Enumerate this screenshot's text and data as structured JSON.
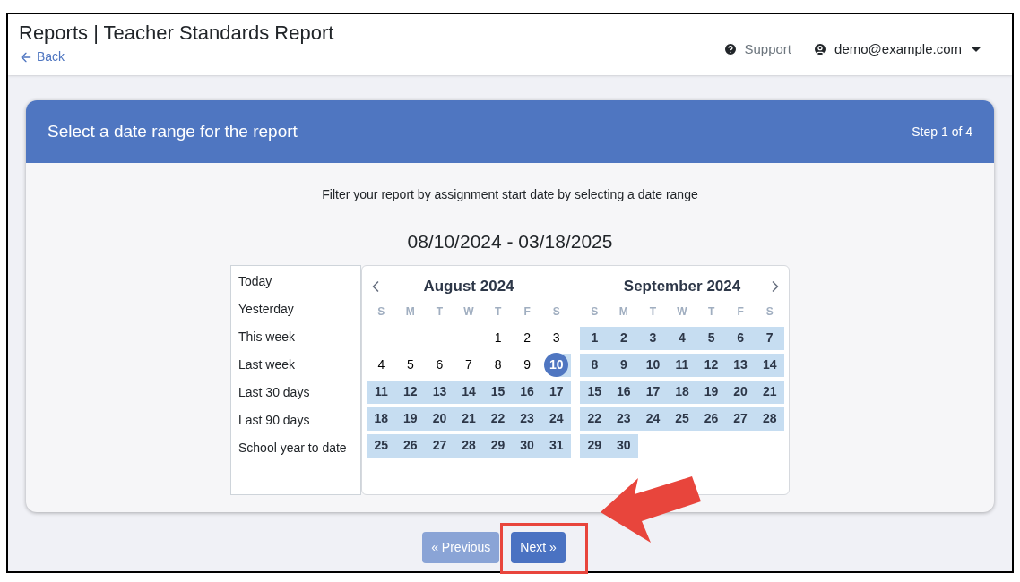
{
  "header": {
    "title": "Reports | Teacher Standards Report",
    "back": "Back",
    "support": "Support",
    "user": "demo@example.com"
  },
  "card": {
    "title": "Select a date range for the report",
    "step": "Step 1 of 4",
    "instruction": "Filter your report by assignment start date by selecting a date range",
    "range": "08/10/2024 - 03/18/2025"
  },
  "presets": [
    {
      "label": "Today"
    },
    {
      "label": "Yesterday"
    },
    {
      "label": "This week"
    },
    {
      "label": "Last week"
    },
    {
      "label": "Last 30 days"
    },
    {
      "label": "Last 90 days"
    },
    {
      "label": "School year to date"
    }
  ],
  "months": [
    {
      "title": "August 2024",
      "weekdays": [
        "S",
        "M",
        "T",
        "W",
        "T",
        "F",
        "S"
      ],
      "weeks": [
        [
          {
            "day": "1",
            "in_range": false,
            "selected": false
          },
          {
            "day": "2",
            "in_range": false,
            "selected": false
          },
          {
            "day": "3",
            "in_range": false,
            "selected": false
          }
        ],
        [
          {
            "day": "4",
            "in_range": false,
            "selected": false
          },
          {
            "day": "5",
            "in_range": false,
            "selected": false
          },
          {
            "day": "6",
            "in_range": false,
            "selected": false
          },
          {
            "day": "7",
            "in_range": false,
            "selected": false
          },
          {
            "day": "8",
            "in_range": false,
            "selected": false
          },
          {
            "day": "9",
            "in_range": false,
            "selected": false
          },
          {
            "day": "10",
            "in_range": true,
            "selected": true
          }
        ],
        [
          {
            "day": "11",
            "in_range": true,
            "selected": false
          },
          {
            "day": "12",
            "in_range": true,
            "selected": false
          },
          {
            "day": "13",
            "in_range": true,
            "selected": false
          },
          {
            "day": "14",
            "in_range": true,
            "selected": false
          },
          {
            "day": "15",
            "in_range": true,
            "selected": false
          },
          {
            "day": "16",
            "in_range": true,
            "selected": false
          },
          {
            "day": "17",
            "in_range": true,
            "selected": false
          }
        ],
        [
          {
            "day": "18",
            "in_range": true,
            "selected": false
          },
          {
            "day": "19",
            "in_range": true,
            "selected": false
          },
          {
            "day": "20",
            "in_range": true,
            "selected": false
          },
          {
            "day": "21",
            "in_range": true,
            "selected": false
          },
          {
            "day": "22",
            "in_range": true,
            "selected": false
          },
          {
            "day": "23",
            "in_range": true,
            "selected": false
          },
          {
            "day": "24",
            "in_range": true,
            "selected": false
          }
        ],
        [
          {
            "day": "25",
            "in_range": true,
            "selected": false
          },
          {
            "day": "26",
            "in_range": true,
            "selected": false
          },
          {
            "day": "27",
            "in_range": true,
            "selected": false
          },
          {
            "day": "28",
            "in_range": true,
            "selected": false
          },
          {
            "day": "29",
            "in_range": true,
            "selected": false
          },
          {
            "day": "30",
            "in_range": true,
            "selected": false
          },
          {
            "day": "31",
            "in_range": true,
            "selected": false
          }
        ]
      ]
    },
    {
      "title": "September 2024",
      "weekdays": [
        "S",
        "M",
        "T",
        "W",
        "T",
        "F",
        "S"
      ],
      "weeks": [
        [
          {
            "day": "1",
            "in_range": true,
            "selected": false
          },
          {
            "day": "2",
            "in_range": true,
            "selected": false
          },
          {
            "day": "3",
            "in_range": true,
            "selected": false
          },
          {
            "day": "4",
            "in_range": true,
            "selected": false
          },
          {
            "day": "5",
            "in_range": true,
            "selected": false
          },
          {
            "day": "6",
            "in_range": true,
            "selected": false
          },
          {
            "day": "7",
            "in_range": true,
            "selected": false
          }
        ],
        [
          {
            "day": "8",
            "in_range": true,
            "selected": false
          },
          {
            "day": "9",
            "in_range": true,
            "selected": false
          },
          {
            "day": "10",
            "in_range": true,
            "selected": false
          },
          {
            "day": "11",
            "in_range": true,
            "selected": false
          },
          {
            "day": "12",
            "in_range": true,
            "selected": false
          },
          {
            "day": "13",
            "in_range": true,
            "selected": false
          },
          {
            "day": "14",
            "in_range": true,
            "selected": false
          }
        ],
        [
          {
            "day": "15",
            "in_range": true,
            "selected": false
          },
          {
            "day": "16",
            "in_range": true,
            "selected": false
          },
          {
            "day": "17",
            "in_range": true,
            "selected": false
          },
          {
            "day": "18",
            "in_range": true,
            "selected": false
          },
          {
            "day": "19",
            "in_range": true,
            "selected": false
          },
          {
            "day": "20",
            "in_range": true,
            "selected": false
          },
          {
            "day": "21",
            "in_range": true,
            "selected": false
          }
        ],
        [
          {
            "day": "22",
            "in_range": true,
            "selected": false
          },
          {
            "day": "23",
            "in_range": true,
            "selected": false
          },
          {
            "day": "24",
            "in_range": true,
            "selected": false
          },
          {
            "day": "25",
            "in_range": true,
            "selected": false
          },
          {
            "day": "26",
            "in_range": true,
            "selected": false
          },
          {
            "day": "27",
            "in_range": true,
            "selected": false
          },
          {
            "day": "28",
            "in_range": true,
            "selected": false
          }
        ],
        [
          {
            "day": "29",
            "in_range": true,
            "selected": false
          },
          {
            "day": "30",
            "in_range": true,
            "selected": false
          }
        ]
      ]
    }
  ],
  "buttons": [
    {
      "label": "« Previous",
      "disabled": true
    },
    {
      "label": "Next »",
      "disabled": false
    }
  ]
}
